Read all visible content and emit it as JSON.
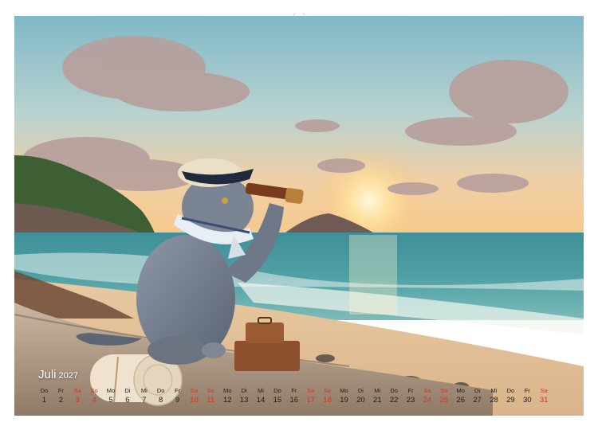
{
  "calendar": {
    "month": "Juli",
    "year": "2027",
    "days": [
      {
        "wd": "Do",
        "n": "1",
        "type": "normal"
      },
      {
        "wd": "Fr",
        "n": "2",
        "type": "normal"
      },
      {
        "wd": "Sa",
        "n": "3",
        "type": "weekend"
      },
      {
        "wd": "So",
        "n": "4",
        "type": "weekend"
      },
      {
        "wd": "Mo",
        "n": "5",
        "type": "normal"
      },
      {
        "wd": "Di",
        "n": "6",
        "type": "normal"
      },
      {
        "wd": "Mi",
        "n": "7",
        "type": "normal"
      },
      {
        "wd": "Do",
        "n": "8",
        "type": "normal"
      },
      {
        "wd": "Fr",
        "n": "9",
        "type": "normal"
      },
      {
        "wd": "Sa",
        "n": "10",
        "type": "weekend"
      },
      {
        "wd": "So",
        "n": "11",
        "type": "weekend"
      },
      {
        "wd": "Mo",
        "n": "12",
        "type": "normal"
      },
      {
        "wd": "Di",
        "n": "13",
        "type": "normal"
      },
      {
        "wd": "Mi",
        "n": "14",
        "type": "normal"
      },
      {
        "wd": "Do",
        "n": "15",
        "type": "normal"
      },
      {
        "wd": "Fr",
        "n": "16",
        "type": "normal"
      },
      {
        "wd": "Sa",
        "n": "17",
        "type": "weekend"
      },
      {
        "wd": "So",
        "n": "18",
        "type": "weekend"
      },
      {
        "wd": "Mo",
        "n": "19",
        "type": "normal"
      },
      {
        "wd": "Di",
        "n": "20",
        "type": "normal"
      },
      {
        "wd": "Mi",
        "n": "21",
        "type": "normal"
      },
      {
        "wd": "Do",
        "n": "22",
        "type": "normal"
      },
      {
        "wd": "Fr",
        "n": "23",
        "type": "normal"
      },
      {
        "wd": "Sa",
        "n": "24",
        "type": "weekend"
      },
      {
        "wd": "So",
        "n": "25",
        "type": "weekend"
      },
      {
        "wd": "Mo",
        "n": "26",
        "type": "normal"
      },
      {
        "wd": "Di",
        "n": "27",
        "type": "normal"
      },
      {
        "wd": "Mi",
        "n": "28",
        "type": "normal"
      },
      {
        "wd": "Do",
        "n": "29",
        "type": "normal"
      },
      {
        "wd": "Fr",
        "n": "30",
        "type": "normal"
      },
      {
        "wd": "Sa",
        "n": "31",
        "type": "weekend"
      }
    ]
  },
  "colors": {
    "weekend": "#d2342b",
    "weekday": "#1d1d1d",
    "month_label": "#ffffff"
  },
  "icons": {
    "binding": "spiral-wire-binding-icon"
  }
}
